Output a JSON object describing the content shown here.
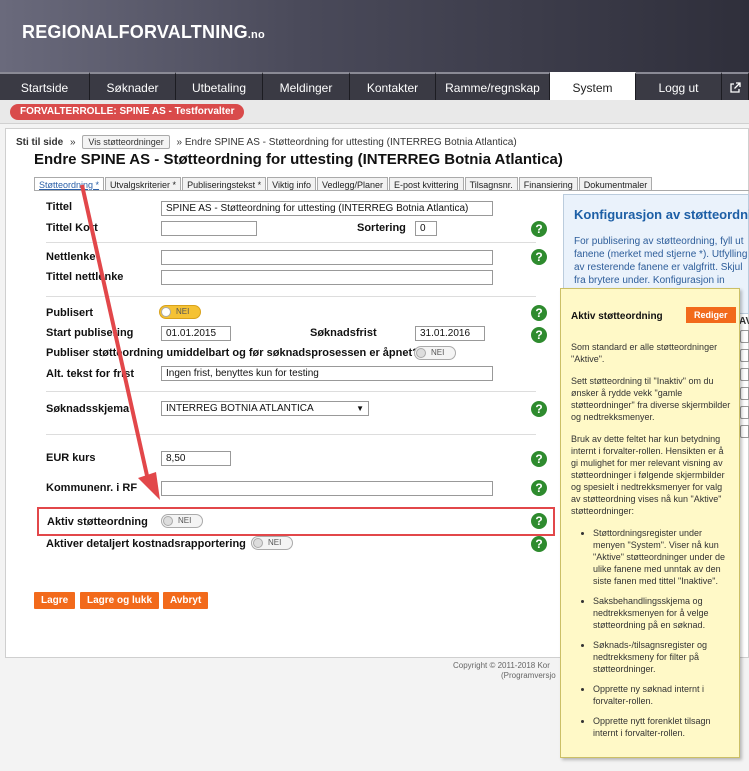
{
  "brand": {
    "name": "REGIONALFORVALTNING",
    "suffix": ".no"
  },
  "nav": [
    "Startside",
    "Søknader",
    "Utbetaling",
    "Meldinger",
    "Kontakter",
    "Ramme/regnskap",
    "System",
    "Logg ut"
  ],
  "nav_active": "System",
  "role": "FORVALTERROLLE: SPINE AS - Testforvalter",
  "breadcrumb": {
    "label": "Sti til side",
    "sep": "»",
    "button": "Vis støtteordninger",
    "current": "Endre SPINE AS - Støtteordning for uttesting (INTERREG Botnia Atlantica)"
  },
  "page_title": "Endre SPINE AS - Støtteordning for uttesting (INTERREG Botnia Atlantica)",
  "tabs": [
    "Støtteordning *",
    "Utvalgskriterier *",
    "Publiseringstekst *",
    "Viktig info",
    "Vedlegg/Planer",
    "E-post kvittering",
    "Tilsagnsnr.",
    "Finansiering",
    "Dokumentmaler"
  ],
  "form": {
    "tittel_label": "Tittel",
    "tittel_value": "SPINE AS - Støtteordning for uttesting (INTERREG Botnia Atlantica)",
    "tittel_kort_label": "Tittel Kort",
    "tittel_kort_value": "",
    "sortering_label": "Sortering",
    "sortering_value": "0",
    "nettlenke_label": "Nettlenke",
    "nettlenke_value": "",
    "tittel_nettlenke_label": "Tittel nettlenke",
    "tittel_nettlenke_value": "",
    "publisert_label": "Publisert",
    "publisert_toggle": "NEI",
    "start_label": "Start publisering",
    "start_value": "01.01.2015",
    "frist_label": "Søknadsfrist",
    "frist_value": "31.01.2016",
    "publiser_label": "Publiser støtteordning umiddelbart og før søknadsprosessen er åpnet?",
    "publiser_toggle": "NEI",
    "alt_label": "Alt. tekst for frist",
    "alt_value": "Ingen frist, benyttes kun for testing",
    "skjema_label": "Søknadsskjema",
    "skjema_value": "INTERREG BOTNIA ATLANTICA",
    "eur_label": "EUR kurs",
    "eur_value": "8,50",
    "kommune_label": "Kommunenr. i RF",
    "kommune_value": "",
    "aktiv_label": "Aktiv støtteordning",
    "aktiv_toggle": "NEI",
    "detaljert_label": "Aktiver detaljert kostnadsrapportering",
    "detaljert_toggle": "NEI"
  },
  "help_glyph": "?",
  "buttons": {
    "save": "Lagre",
    "save_close": "Lagre og lukk",
    "cancel": "Avbryt"
  },
  "side_panel": {
    "title": "Konfigurasjon av støtteordning",
    "text": "For publisering av støtteordning, fyll ut fanene (merket med stjerne *). Utfylling av resterende fanene er valgfritt. Skjul fra brytere under. Konfigurasjon in"
  },
  "side_panel_extra": "AV",
  "tooltip": {
    "title": "Aktiv støtteordning",
    "edit": "Rediger",
    "p1": "Som standard er alle støtteordninger \"Aktive\".",
    "p2": "Sett støtteordning til \"Inaktiv\" om du ønsker å rydde vekk \"gamle støtteordninger\" fra diverse skjermbilder og nedtrekksmenyer.",
    "p3": "Bruk av dette feltet har kun betydning internt i forvalter-rollen. Hensikten er å gi mulighet for mer relevant visning av støtteordninger i følgende skjermbilder og spesielt i nedtrekksmenyer for valg av støtteordning vises nå kun \"Aktive\" støtteordninger:",
    "items": [
      "Støttordningsregister under menyen \"System\". Viser nå kun \"Aktive\" støtteordninger under de ulike fanene med unntak av den siste fanen med tittel \"Inaktive\".",
      "Saksbehandlingsskjema og nedtrekksmenyen for å velge støtteordning på en søknad.",
      "Søknads-/tilsagnsregister og nedtrekksmeny for filter på støtteordninger.",
      "Opprette ny søknad internt i forvalter-rollen.",
      "Opprette nytt forenklet tilsagn internt i forvalter-rollen."
    ]
  },
  "footer": {
    "line1": "Copyright © 2011-2018 Kor",
    "line2": "(Programversjo"
  },
  "colors": {
    "accent": "#f26a1b",
    "role": "#d94b4b",
    "help": "#2e8b2e",
    "highlight": "#e2474a",
    "tooltip_bg": "#fff9c7"
  }
}
